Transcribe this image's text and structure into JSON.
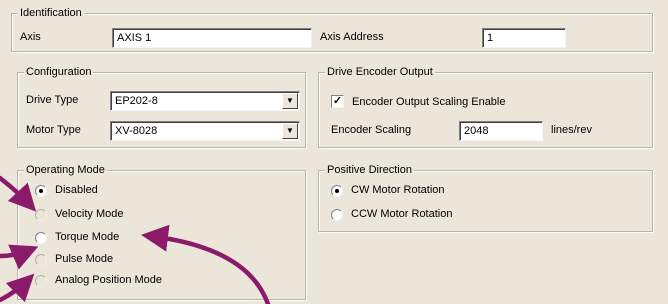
{
  "identification": {
    "legend": "Identification",
    "axis_label": "Axis",
    "axis_value": "AXIS 1",
    "address_label": "Axis Address",
    "address_value": "1"
  },
  "configuration": {
    "legend": "Configuration",
    "drive_type_label": "Drive Type",
    "drive_type_value": "EP202-8",
    "motor_type_label": "Motor Type",
    "motor_type_value": "XV-8028"
  },
  "encoder_output": {
    "legend": "Drive Encoder Output",
    "scaling_enable_label": "Encoder Output Scaling Enable",
    "scaling_enable_checked": true,
    "scaling_label": "Encoder Scaling",
    "scaling_value": "2048",
    "scaling_unit": "lines/rev"
  },
  "operating_mode": {
    "legend": "Operating Mode",
    "options": [
      {
        "label": "Disabled",
        "selected": true
      },
      {
        "label": "Velocity Mode",
        "selected": false
      },
      {
        "label": "Torque Mode",
        "selected": false
      },
      {
        "label": "Pulse Mode",
        "selected": false
      },
      {
        "label": "Analog Position Mode",
        "selected": false
      }
    ]
  },
  "positive_direction": {
    "legend": "Positive Direction",
    "options": [
      {
        "label": "CW Motor Rotation",
        "selected": true
      },
      {
        "label": "CCW Motor Rotation",
        "selected": false
      }
    ]
  },
  "icons": {
    "dropdown": "chevron-down-icon",
    "check": "check-icon",
    "annotation_arrow": "arrow-icon"
  },
  "colors": {
    "background": "#ece6da",
    "annotation_arrow": "#8b1a6b"
  }
}
